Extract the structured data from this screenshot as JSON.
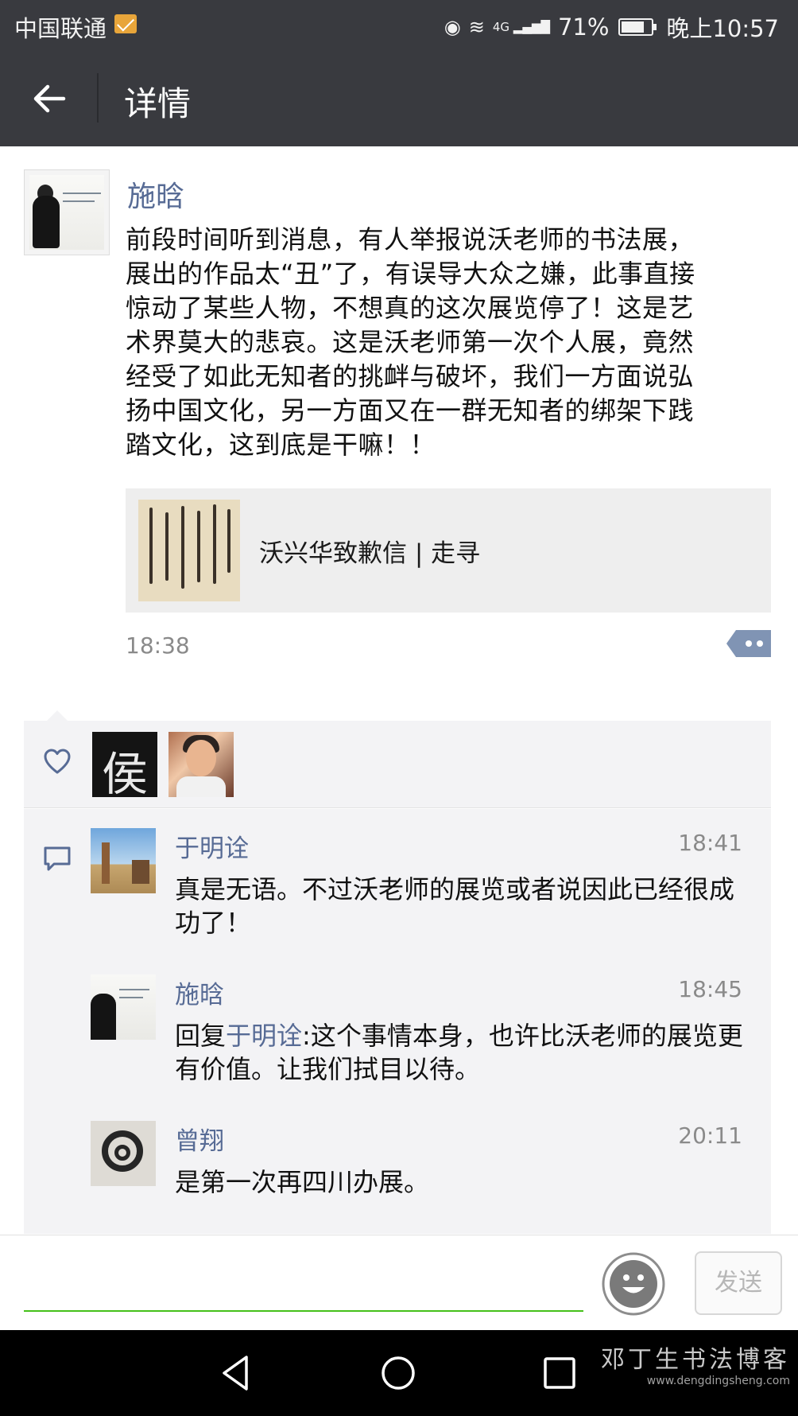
{
  "status_bar": {
    "carrier": "中国联通",
    "network": "4G",
    "battery": "71%",
    "time": "晚上10:57"
  },
  "header": {
    "title": "详情",
    "back_icon": "arrow-left-icon"
  },
  "post": {
    "author": "施晗",
    "paragraphs": [
      "前段时间听到消息，有人举报说沃老师的书法展，",
      "展出的作品太“丑”了，有误导大众之嫌，此事直接",
      "惊动了某些人物，不想真的这次展览停了！这是艺",
      "术界莫大的悲哀。这是沃老师第一次个人展，竟然",
      "经受了如此无知者的挑衅与破坏，我们一方面说弘",
      "扬中国文化，另一方面又在一群无知者的绑架下践",
      "踏文化，这到底是干嘛！！"
    ],
    "shared_link_title": "沃兴华致歉信 | 走寻",
    "time": "18:38"
  },
  "likes": {
    "icon": "heart-icon",
    "avatar1_glyph": "侯"
  },
  "comments": [
    {
      "author": "于明诠",
      "time": "18:41",
      "text": "真是无语。不过沃老师的展览或者说因此已经很成功了！"
    },
    {
      "author": "施晗",
      "time": "18:45",
      "reply_prefix": "回复",
      "reply_to": "于明诠",
      "text": ":这个事情本身，也许比沃老师的展览更有价值。让我们拭目以待。"
    },
    {
      "author": "曾翔",
      "time": "20:11",
      "text": "是第一次再四川办展。"
    }
  ],
  "input_bar": {
    "placeholder": "",
    "send_label": "发送"
  },
  "watermark": {
    "title": "邓丁生书法博客",
    "url": "www.dengdingsheng.com"
  },
  "colors": {
    "header_bg": "#393a3f",
    "link_blue": "#576b95",
    "input_underline": "#45c01a",
    "panel_bg": "#f3f3f5"
  }
}
